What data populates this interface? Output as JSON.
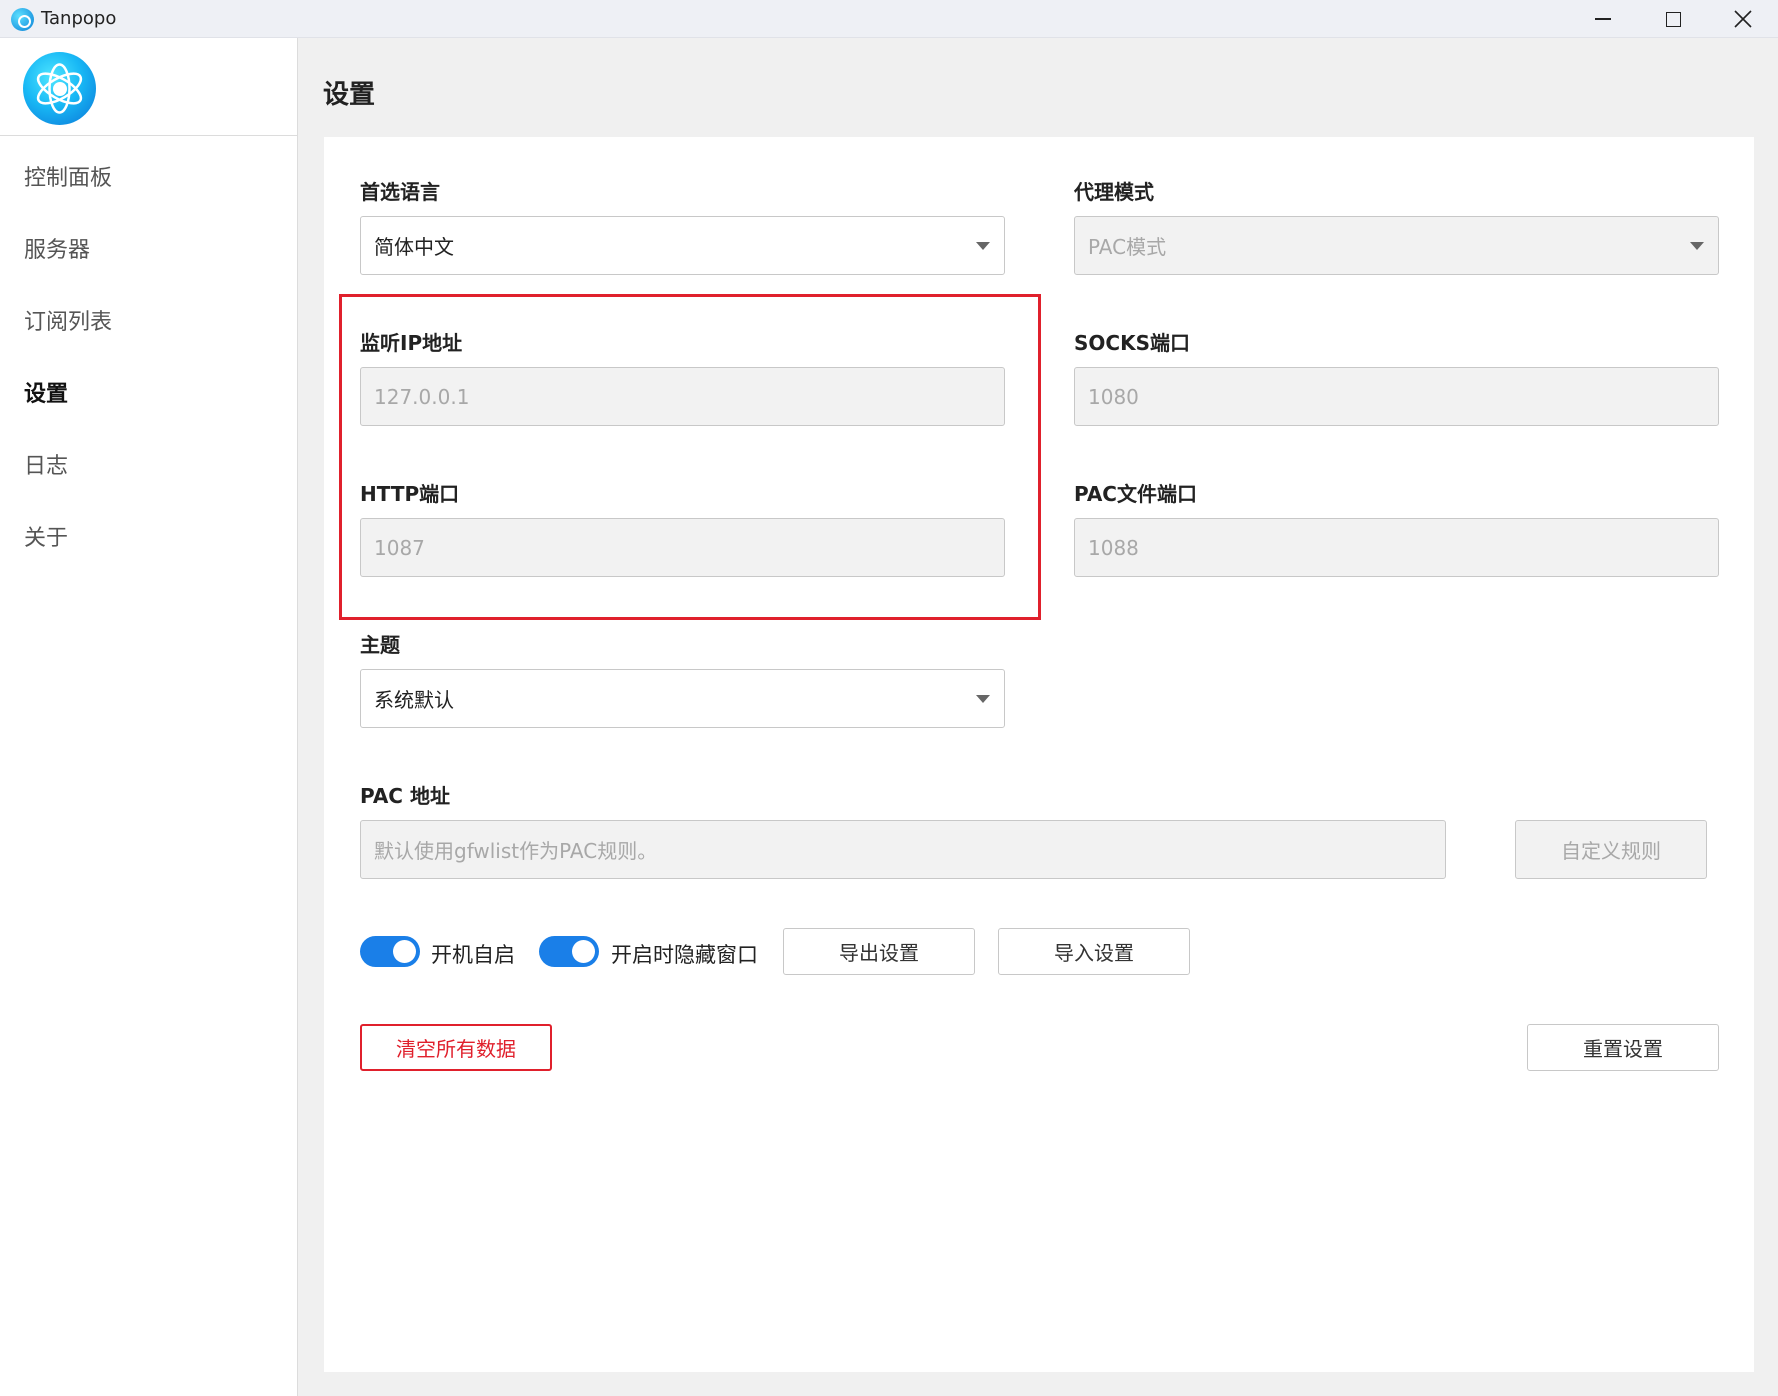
{
  "window": {
    "title": "Tanpopo"
  },
  "sidebar": {
    "items": [
      {
        "label": "控制面板"
      },
      {
        "label": "服务器"
      },
      {
        "label": "订阅列表"
      },
      {
        "label": "设置",
        "active": true
      },
      {
        "label": "日志"
      },
      {
        "label": "关于"
      }
    ]
  },
  "page": {
    "title": "设置"
  },
  "settings": {
    "language": {
      "label": "首选语言",
      "value": "简体中文"
    },
    "proxy_mode": {
      "label": "代理模式",
      "value": "PAC模式"
    },
    "listen_ip": {
      "label": "监听IP地址",
      "placeholder": "127.0.0.1"
    },
    "socks_port": {
      "label": "SOCKS端口",
      "placeholder": "1080"
    },
    "http_port": {
      "label": "HTTP端口",
      "placeholder": "1087"
    },
    "pac_file_port": {
      "label": "PAC文件端口",
      "placeholder": "1088"
    },
    "theme": {
      "label": "主题",
      "value": "系统默认"
    },
    "pac_address": {
      "label": "PAC 地址",
      "placeholder": "默认使用gfwlist作为PAC规则。"
    },
    "custom_rules_button": "自定义规则",
    "autostart": {
      "label": "开机自启",
      "on": true
    },
    "hide_on_start": {
      "label": "开启时隐藏窗口",
      "on": true
    },
    "export_button": "导出设置",
    "import_button": "导入设置",
    "clear_data_button": "清空所有数据",
    "reset_button": "重置设置"
  },
  "colors": {
    "accent": "#1a7fe8",
    "danger": "#e0202c",
    "highlight": "#e0202c"
  }
}
